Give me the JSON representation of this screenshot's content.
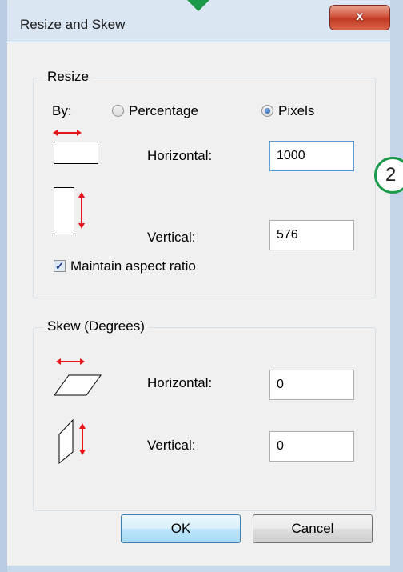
{
  "window": {
    "title": "Resize and Skew",
    "close_icon_glyph": "x"
  },
  "resize": {
    "legend": "Resize",
    "by_label": "By:",
    "options": [
      "Percentage",
      "Pixels"
    ],
    "selected": "Pixels",
    "horizontal_label": "Horizontal:",
    "horizontal_value": "1000",
    "vertical_label": "Vertical:",
    "vertical_value": "576",
    "maintain_aspect_label": "Maintain aspect ratio",
    "maintain_aspect_checked": true
  },
  "skew": {
    "legend": "Skew (Degrees)",
    "horizontal_label": "Horizontal:",
    "horizontal_value": "0",
    "vertical_label": "Vertical:",
    "vertical_value": "0"
  },
  "buttons": {
    "ok": "OK",
    "cancel": "Cancel"
  },
  "annotation": {
    "step_number": "2"
  },
  "colors": {
    "arrow_red": "#e8141c",
    "marker_green": "#1b9a4a"
  }
}
